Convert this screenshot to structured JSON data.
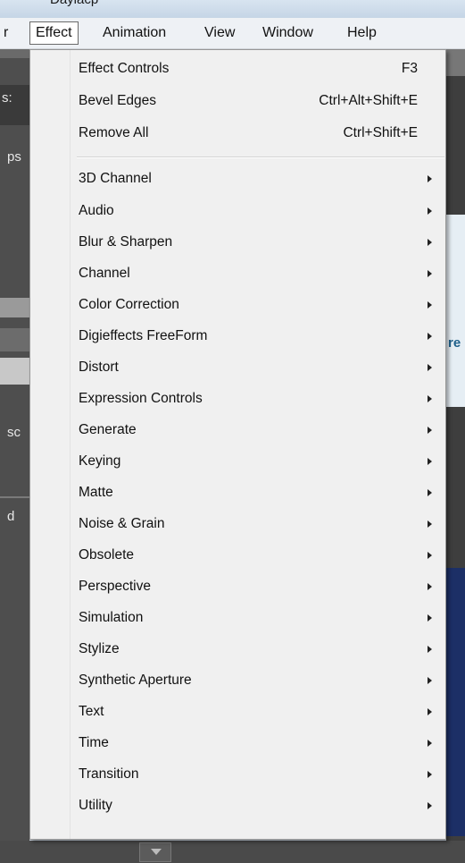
{
  "window": {
    "title_fragment": "Daylacp"
  },
  "menubar": {
    "items": [
      {
        "label": "r",
        "active": false
      },
      {
        "label": "Effect",
        "active": true
      },
      {
        "label": "Animation",
        "active": false
      },
      {
        "label": "View",
        "active": false
      },
      {
        "label": "Window",
        "active": false
      },
      {
        "label": "Help",
        "active": false
      }
    ]
  },
  "background": {
    "left_fragments": [
      "s:",
      "ps",
      "sc",
      "d"
    ],
    "right_fragments": [
      "re"
    ]
  },
  "effect_menu": {
    "commands": [
      {
        "label": "Effect Controls",
        "shortcut": "F3"
      },
      {
        "label": "Bevel Edges",
        "shortcut": "Ctrl+Alt+Shift+E"
      },
      {
        "label": "Remove All",
        "shortcut": "Ctrl+Shift+E"
      }
    ],
    "submenus": [
      "3D Channel",
      "Audio",
      "Blur & Sharpen",
      "Channel",
      "Color Correction",
      "Digieffects FreeForm",
      "Distort",
      "Expression Controls",
      "Generate",
      "Keying",
      "Matte",
      "Noise & Grain",
      "Obsolete",
      "Perspective",
      "Simulation",
      "Stylize",
      "Synthetic Aperture",
      "Text",
      "Time",
      "Transition",
      "Utility"
    ]
  },
  "colors": {
    "menu_bg": "#f0f0f0",
    "menubar_bg": "#eef1f5",
    "app_dark": "#4e4e4e"
  }
}
